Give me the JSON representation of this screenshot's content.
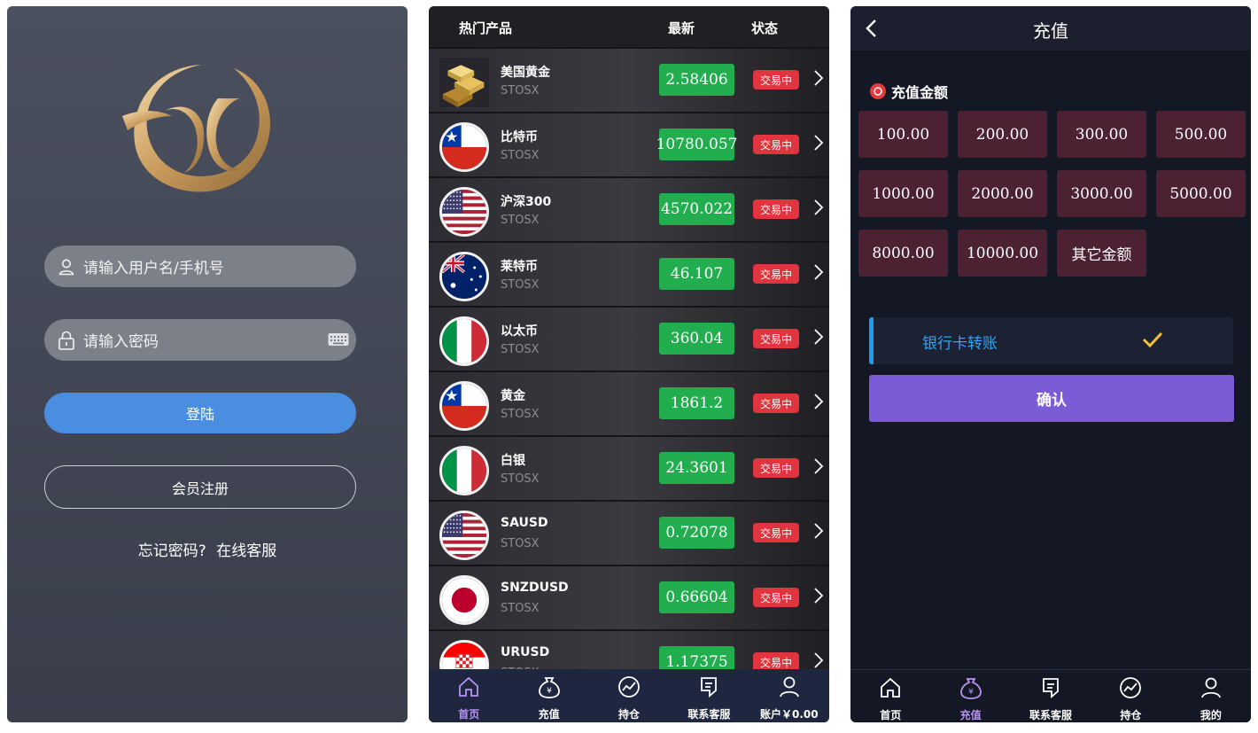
{
  "login": {
    "username_placeholder": "请输入用户名/手机号",
    "password_placeholder": "请输入密码",
    "login_button": "登陆",
    "register_button": "会员注册",
    "forgot_link": "忘记密码?",
    "service_link": "在线客服"
  },
  "market": {
    "headers": {
      "product": "热门产品",
      "latest": "最新",
      "status": "状态"
    },
    "rows": [
      {
        "name": "美国黄金",
        "sub": "STOSX",
        "price": "2.58406",
        "status": "交易中",
        "icon": "gold-bars-icon"
      },
      {
        "name": "比特币",
        "sub": "STOSX",
        "price": "10780.057",
        "status": "交易中",
        "icon": "chile-flag-icon"
      },
      {
        "name": "沪深300",
        "sub": "STOSX",
        "price": "4570.022",
        "status": "交易中",
        "icon": "usa-flag-icon"
      },
      {
        "name": "莱特币",
        "sub": "STOSX",
        "price": "46.107",
        "status": "交易中",
        "icon": "australia-flag-icon"
      },
      {
        "name": "以太币",
        "sub": "STOSX",
        "price": "360.04",
        "status": "交易中",
        "icon": "italy-flag-icon"
      },
      {
        "name": "黄金",
        "sub": "STOSX",
        "price": "1861.2",
        "status": "交易中",
        "icon": "chile-flag-icon"
      },
      {
        "name": "白银",
        "sub": "STOSX",
        "price": "24.3601",
        "status": "交易中",
        "icon": "italy-flag-icon"
      },
      {
        "name": "SAUSD",
        "sub": "STOSX",
        "price": "0.72078",
        "status": "交易中",
        "icon": "usa-flag-icon"
      },
      {
        "name": "SNZDUSD",
        "sub": "STOSX",
        "price": "0.66604",
        "status": "交易中",
        "icon": "japan-flag-icon"
      },
      {
        "name": "URUSD",
        "sub": "STOSX",
        "price": "1.17375",
        "status": "交易中",
        "icon": "croatia-flag-icon"
      }
    ],
    "tabs": [
      "首页",
      "充值",
      "持仓",
      "联系客服",
      "账户￥0.00"
    ],
    "active_tab": "首页"
  },
  "recharge": {
    "title": "充值",
    "section_label": "充值金额",
    "amounts": [
      "100.00",
      "200.00",
      "300.00",
      "500.00",
      "1000.00",
      "2000.00",
      "3000.00",
      "5000.00",
      "8000.00",
      "10000.00",
      "其它金额"
    ],
    "method": "银行卡转账",
    "confirm": "确认",
    "tabs": [
      "首页",
      "充值",
      "联系客服",
      "持仓",
      "我的"
    ],
    "active_tab": "充值"
  },
  "colors": {
    "price_green": "#22ad4f",
    "status_red": "#e0343f",
    "login_blue": "#4a8ee2",
    "confirm_purple": "#7c5bd6",
    "amount_bg": "#4c2131",
    "active_tab": "#b794f4"
  }
}
